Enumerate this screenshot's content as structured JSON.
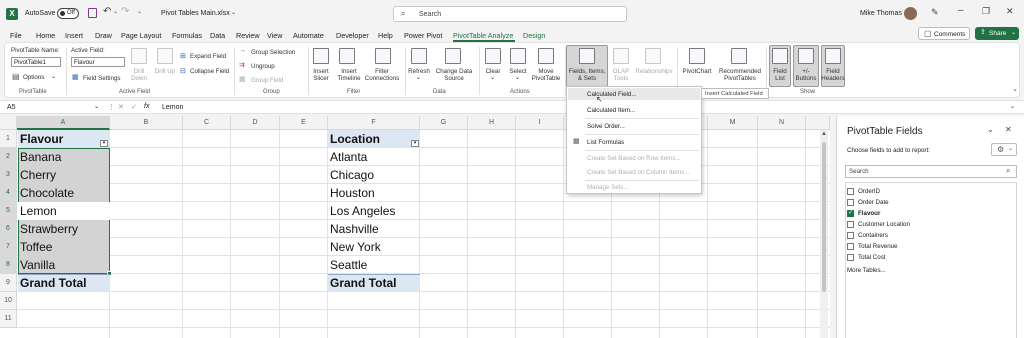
{
  "titlebar": {
    "autosave_label": "AutoSave",
    "autosave_state": "Off",
    "filename": "Pivot Tables Main.xlsx",
    "search_placeholder": "Search",
    "user_name": "Mike Thomas"
  },
  "menu": {
    "tabs": [
      "File",
      "Home",
      "Insert",
      "Draw",
      "Page Layout",
      "Formulas",
      "Data",
      "Review",
      "View",
      "Automate",
      "Developer",
      "Help",
      "Power Pivot",
      "PivotTable Analyze",
      "Design"
    ],
    "active_tab": "PivotTable Analyze",
    "comments_label": "Comments",
    "share_label": "Share"
  },
  "ribbon": {
    "pivottable": {
      "name_label": "PivotTable Name:",
      "name_value": "PivotTable1",
      "options_label": "Options",
      "group_label": "PivotTable"
    },
    "active_field": {
      "label": "Active Field:",
      "value": "Flavour",
      "settings_label": "Field Settings",
      "drill_down": "Drill Down",
      "drill_up": "Drill Up",
      "expand": "Expand Field",
      "collapse": "Collapse Field",
      "group_label": "Active Field"
    },
    "group": {
      "selection": "Group Selection",
      "ungroup": "Ungroup",
      "field": "Group Field",
      "group_label": "Group"
    },
    "filter": {
      "slicer": "Insert Slicer",
      "timeline": "Insert Timeline",
      "connections": "Filter Connections",
      "group_label": "Filter"
    },
    "data": {
      "refresh": "Refresh",
      "change_source": "Change Data Source",
      "group_label": "Data"
    },
    "actions": {
      "clear": "Clear",
      "select": "Select",
      "move": "Move PivotTable",
      "group_label": "Actions"
    },
    "calculations": {
      "fields_items": "Fields, Items, & Sets",
      "olap": "OLAP Tools",
      "relationships": "Relationships"
    },
    "tools": {
      "pivotchart": "PivotChart",
      "recommended": "Recommended PivotTables"
    },
    "show": {
      "field_list": "Field List",
      "buttons": "+/- Buttons",
      "headers": "Field Headers",
      "group_label": "Show"
    }
  },
  "dropdown": {
    "items": [
      {
        "label": "Calculated Field...",
        "enabled": true
      },
      {
        "label": "Calculated Item...",
        "enabled": true
      },
      {
        "label": "Solve Order...",
        "enabled": true
      },
      {
        "label": "List Formulas",
        "enabled": true
      },
      {
        "label": "Create Set Based on Row Items...",
        "enabled": false
      },
      {
        "label": "Create Set Based on Column Items...",
        "enabled": false
      },
      {
        "label": "Manage Sets...",
        "enabled": false
      }
    ],
    "tooltip": "Insert Calculated Field"
  },
  "formula_bar": {
    "name_box": "A5",
    "fx": "fx",
    "value": "Lemon"
  },
  "sheet": {
    "columns": [
      "A",
      "B",
      "C",
      "D",
      "E",
      "F",
      "G",
      "H",
      "I",
      "J",
      "K",
      "L",
      "M",
      "N"
    ],
    "rows": [
      "1",
      "2",
      "3",
      "4",
      "5",
      "6",
      "7",
      "8",
      "9",
      "10",
      "11"
    ],
    "pivot1": {
      "header": "Flavour",
      "items": [
        "Banana",
        "Cherry",
        "Chocolate",
        "Lemon",
        "Strawberry",
        "Toffee",
        "Vanilla"
      ],
      "total": "Grand Total"
    },
    "pivot2": {
      "header": "Location",
      "items": [
        "Atlanta",
        "Chicago",
        "Houston",
        "Los Angeles",
        "Nashville",
        "New York",
        "Seattle"
      ],
      "total": "Grand Total"
    }
  },
  "pane": {
    "title": "PivotTable Fields",
    "subtitle": "Choose fields to add to report:",
    "search_placeholder": "Search",
    "fields": [
      {
        "label": "OrderID",
        "checked": false
      },
      {
        "label": "Order Date",
        "checked": false
      },
      {
        "label": "Flavour",
        "checked": true
      },
      {
        "label": "Customer Location",
        "checked": false
      },
      {
        "label": "Containers",
        "checked": false
      },
      {
        "label": "Total Revenue",
        "checked": false
      },
      {
        "label": "Total Cost",
        "checked": false
      }
    ],
    "more_tables": "More Tables..."
  },
  "colors": {
    "accent": "#217346",
    "pivot_header": "#dde6f3",
    "selection": "#d3d3d3"
  }
}
